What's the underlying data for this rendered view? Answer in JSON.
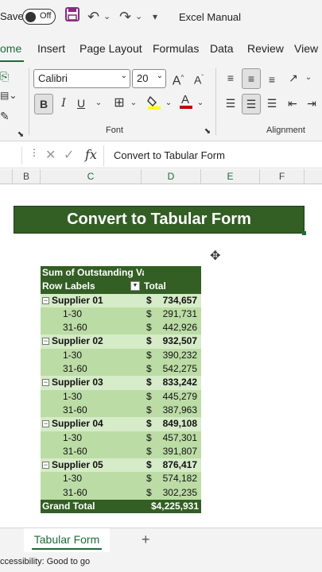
{
  "qat": {
    "autosave_label": "Save",
    "autosave_state": "Off",
    "title": "Excel Manual"
  },
  "ribbon_tabs": [
    "ome",
    "Insert",
    "Page Layout",
    "Formulas",
    "Data",
    "Review",
    "View"
  ],
  "ribbon": {
    "font_name": "Calibri",
    "font_size": "20",
    "bold_label": "B",
    "italic_label": "I",
    "underline_label": "U",
    "font_group_label": "Font",
    "alignment_group_label": "Alignment",
    "font_color": "#c00000",
    "highlight_color": "#ffff00"
  },
  "formula_bar": {
    "fx_label": "fx",
    "content": "Convert to Tabular Form"
  },
  "columns": [
    "B",
    "C",
    "D",
    "E",
    "F"
  ],
  "banner": {
    "text": "Convert to Tabular Form"
  },
  "pivot": {
    "header_value": "Sum of Outstanding Va",
    "row_labels": "Row Labels",
    "total_header": "Total",
    "rows": [
      {
        "type": "sup",
        "label": "Supplier 01",
        "cur": "$",
        "amt": "734,657"
      },
      {
        "type": "sub",
        "label": "1-30",
        "cur": "$",
        "amt": "291,731"
      },
      {
        "type": "sub",
        "label": "31-60",
        "cur": "$",
        "amt": "442,926"
      },
      {
        "type": "sup",
        "label": "Supplier 02",
        "cur": "$",
        "amt": "932,507"
      },
      {
        "type": "sub",
        "label": "1-30",
        "cur": "$",
        "amt": "390,232"
      },
      {
        "type": "sub",
        "label": "31-60",
        "cur": "$",
        "amt": "542,275"
      },
      {
        "type": "sup",
        "label": "Supplier 03",
        "cur": "$",
        "amt": "833,242"
      },
      {
        "type": "sub",
        "label": "1-30",
        "cur": "$",
        "amt": "445,279"
      },
      {
        "type": "sub",
        "label": "31-60",
        "cur": "$",
        "amt": "387,963"
      },
      {
        "type": "sup",
        "label": "Supplier 04",
        "cur": "$",
        "amt": "849,108"
      },
      {
        "type": "sub",
        "label": "1-30",
        "cur": "$",
        "amt": "457,301"
      },
      {
        "type": "sub",
        "label": "31-60",
        "cur": "$",
        "amt": "391,807"
      },
      {
        "type": "sup",
        "label": "Supplier 05",
        "cur": "$",
        "amt": "876,417"
      },
      {
        "type": "sub",
        "label": "1-30",
        "cur": "$",
        "amt": "574,182"
      },
      {
        "type": "sub",
        "label": "31-60",
        "cur": "$",
        "amt": "302,235"
      }
    ],
    "grand_total_label": "Grand Total",
    "grand_total_value": "$4,225,931"
  },
  "sheet": {
    "tab_name": "Tabular Form",
    "add_label": "+"
  },
  "status": {
    "text": "ccessibility: Good to go"
  },
  "colors": {
    "accent": "#1e6b3a",
    "pivot_dark": "#335e24",
    "pivot_light": "#d6ebc8",
    "pivot_mid": "#bcdca6"
  }
}
